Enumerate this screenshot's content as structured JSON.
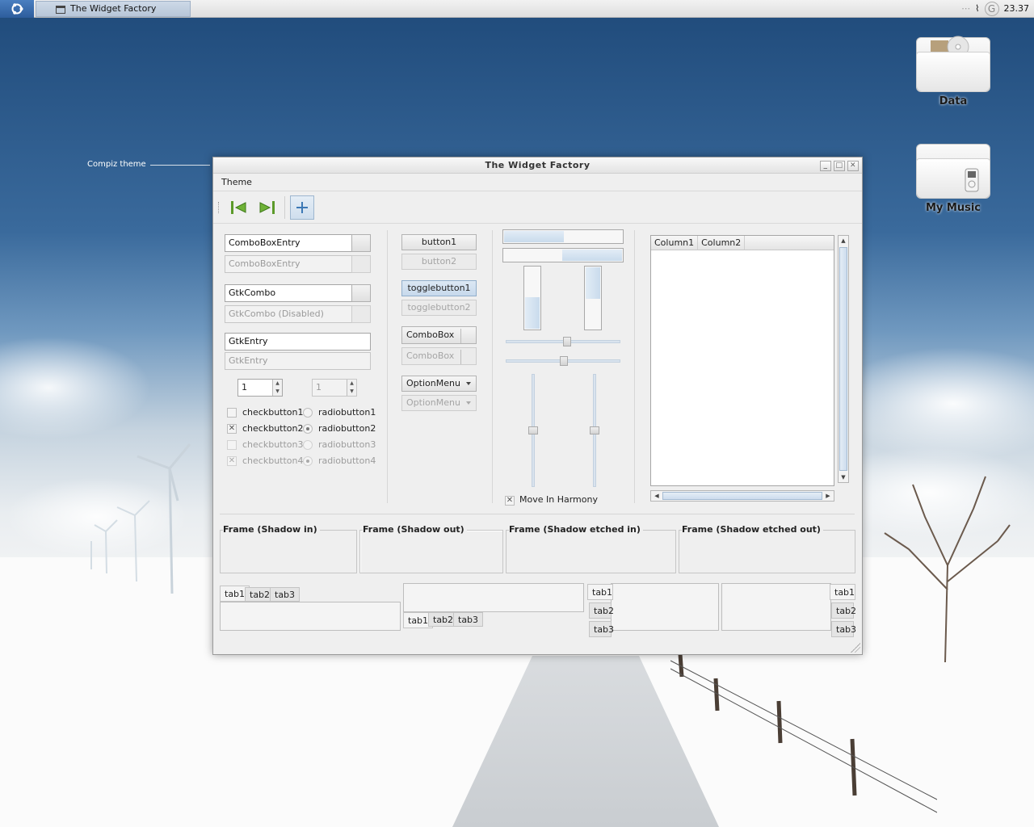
{
  "panel": {
    "task_title": "The Widget Factory",
    "clock": "23.37"
  },
  "desktop": {
    "icons": [
      {
        "label": "Data"
      },
      {
        "label": "My Music"
      }
    ],
    "annotation": "Compiz theme"
  },
  "window": {
    "title": "The Widget Factory",
    "menu": [
      "Theme"
    ],
    "left": {
      "combobox_entry": "ComboBoxEntry",
      "combobox_entry_disabled": "ComboBoxEntry",
      "gtkcombo": "GtkCombo",
      "gtkcombo_disabled": "GtkCombo (Disabled)",
      "gtkentry": "GtkEntry",
      "gtkentry_disabled": "GtkEntry",
      "spin_value": "1",
      "spin_disabled_value": "1",
      "checks": [
        {
          "label": "checkbutton1",
          "checked": false,
          "disabled": false
        },
        {
          "label": "checkbutton2",
          "checked": true,
          "disabled": false
        },
        {
          "label": "checkbutton3",
          "checked": false,
          "disabled": true
        },
        {
          "label": "checkbutton4",
          "checked": true,
          "disabled": true
        }
      ],
      "radios": [
        {
          "label": "radiobutton1",
          "checked": false,
          "disabled": false
        },
        {
          "label": "radiobutton2",
          "checked": true,
          "disabled": false
        },
        {
          "label": "radiobutton3",
          "checked": false,
          "disabled": true
        },
        {
          "label": "radiobutton4",
          "checked": true,
          "disabled": true
        }
      ]
    },
    "middle": {
      "button1": "button1",
      "button2": "button2",
      "togglebutton1": "togglebutton1",
      "togglebutton2": "togglebutton2",
      "combobox": "ComboBox",
      "combobox_disabled": "ComboBox",
      "optionmenu": "OptionMenu",
      "optionmenu_disabled": "OptionMenu"
    },
    "ranges": {
      "move_in_harmony": "Move In Harmony",
      "hprogress1": 0.5,
      "hprogress2": 0.5,
      "vprogress1": 0.5,
      "vprogress2": 0.5
    },
    "tree": {
      "columns": [
        "Column1",
        "Column2"
      ]
    },
    "frames": [
      "Frame (Shadow in)",
      "Frame (Shadow out)",
      "Frame (Shadow etched in)",
      "Frame (Shadow etched out)"
    ],
    "tabs": [
      "tab1",
      "tab2",
      "tab3"
    ]
  }
}
